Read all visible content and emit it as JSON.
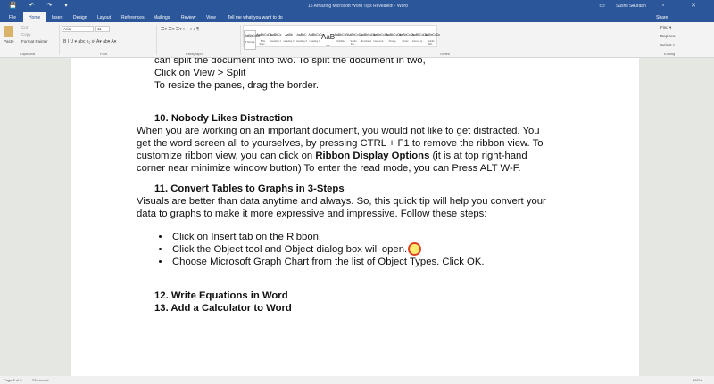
{
  "window": {
    "title": "15 Amazing Microsoft Word Tips Revealed! - Word",
    "user": "Sushil Sourabh",
    "quick_access": "💾 ↶ ↷ ▾",
    "controls": "▭ – ▫ ✕"
  },
  "tabs": [
    "File",
    "Home",
    "Insert",
    "Design",
    "Layout",
    "References",
    "Mailings",
    "Review",
    "View"
  ],
  "tell_me": "Tell me what you want to do",
  "share": "Share",
  "clipboard": {
    "paste": "Paste",
    "cut": "Cut",
    "copy": "Copy",
    "format_painter": "Format Painter",
    "label": "Clipboard"
  },
  "font": {
    "name": "Arial",
    "size": "11",
    "label": "Font",
    "buttons": "B  I  U ▾ abc x₂ x²  A▾  ab▾ A▾"
  },
  "paragraph": {
    "label": "Paragraph",
    "buttons": "☰▾ ☰▾ ☰▾  ⇤ ⇥  ↕ ¶"
  },
  "styles": {
    "label": "Styles",
    "items": [
      {
        "preview": "AaBbCcDc",
        "name": "¶ Normal"
      },
      {
        "preview": "AaBbCcDc",
        "name": "¶ No Spac..."
      },
      {
        "preview": "AaBbCc",
        "name": "Heading 1"
      },
      {
        "preview": "AaBb",
        "name": "Heading 2"
      },
      {
        "preview": "AaBbC",
        "name": "Heading 3"
      },
      {
        "preview": "AaBbCcDc",
        "name": "Heading 4"
      },
      {
        "preview": "AaB",
        "name": "Title"
      },
      {
        "preview": "AaBbCcE",
        "name": "Subtitle"
      },
      {
        "preview": "AaBbCcDc",
        "name": "Subtle Em..."
      },
      {
        "preview": "AaBbCcDc",
        "name": "Emphasis"
      },
      {
        "preview": "AaBbCcDc",
        "name": "Intense E..."
      },
      {
        "preview": "AaBbCcDc",
        "name": "Strong"
      },
      {
        "preview": "AaBbCcDc",
        "name": "Quote"
      },
      {
        "preview": "AaBbCcDc",
        "name": "Intense Q..."
      },
      {
        "preview": "AaBbCcDc",
        "name": "Subtle Ref..."
      }
    ]
  },
  "editing": {
    "label": "Editing",
    "find": "Find ▾",
    "replace": "Replace",
    "select": "Select ▾"
  },
  "document": {
    "l1": "can split the document into two. To split the document in two,",
    "l2": "Click on View > Split",
    "l3": "To resize the panes, drag the border.",
    "h10": "10. Nobody Likes Distraction",
    "p10a": "When you are working on an important document, you would not like to get distracted. You get the word screen all to yourselves, by pressing CTRL + F1 to remove the ribbon view. To customize ribbon view, you can click on ",
    "p10b": "Ribbon Display Options",
    "p10c": " (it is at top right-hand corner near minimize window button) To enter the read mode, you can Press ALT W-F.",
    "h11": "11. Convert Tables to Graphs in 3-Steps",
    "p11": "Visuals are better than data anytime and always. So, this quick tip will help you convert your data to graphs to make it more expressive and impressive. Follow these steps:",
    "bullets": [
      "Click on Insert tab on the Ribbon.",
      "Click the Object tool and Object dialog box will open.",
      "Choose Microsoft Graph Chart from the list of Object Types. Click OK."
    ],
    "h12": "12. Write Equations in Word",
    "h13": "13. Add a Calculator to Word"
  },
  "status": {
    "page": "Page 2 of 3",
    "words": "700 words",
    "zoom": "100%"
  }
}
